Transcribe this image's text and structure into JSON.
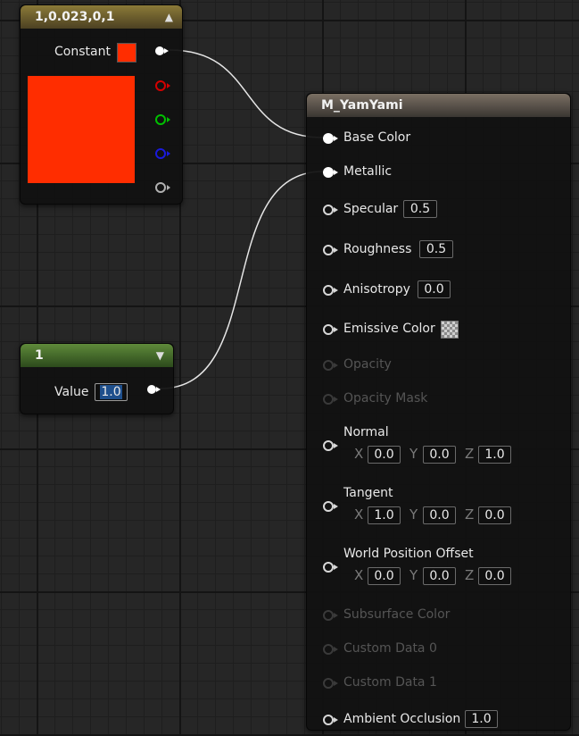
{
  "constant_node": {
    "title": "1,0.023,0,1",
    "label": "Constant",
    "color": "#ff2d00",
    "pins": [
      "white",
      "red",
      "green",
      "blue",
      "alpha"
    ]
  },
  "value_node": {
    "title": "1",
    "label": "Value",
    "value": "1.0"
  },
  "material_node": {
    "title": "M_YamYami",
    "inputs": {
      "base_color": {
        "label": "Base Color"
      },
      "metallic": {
        "label": "Metallic"
      },
      "specular": {
        "label": "Specular",
        "value": "0.5"
      },
      "roughness": {
        "label": "Roughness",
        "value": "0.5"
      },
      "anisotropy": {
        "label": "Anisotropy",
        "value": "0.0"
      },
      "emissive": {
        "label": "Emissive Color"
      },
      "opacity": {
        "label": "Opacity"
      },
      "opacity_mask": {
        "label": "Opacity Mask"
      },
      "normal": {
        "label": "Normal",
        "x": "0.0",
        "y": "0.0",
        "z": "1.0"
      },
      "tangent": {
        "label": "Tangent",
        "x": "1.0",
        "y": "0.0",
        "z": "0.0"
      },
      "wpo": {
        "label": "World Position Offset",
        "x": "0.0",
        "y": "0.0",
        "z": "0.0"
      },
      "subsurface": {
        "label": "Subsurface Color"
      },
      "custom0": {
        "label": "Custom Data 0"
      },
      "custom1": {
        "label": "Custom Data 1"
      },
      "ao": {
        "label": "Ambient Occlusion",
        "value": "1.0"
      }
    }
  },
  "axes": {
    "x": "X",
    "y": "Y",
    "z": "Z"
  },
  "colors": {
    "wire": "#e6e6e6",
    "pin_red": "#d40000",
    "pin_green": "#00c000",
    "pin_blue": "#1a1adc",
    "pin_alpha": "#b0b0b0"
  }
}
